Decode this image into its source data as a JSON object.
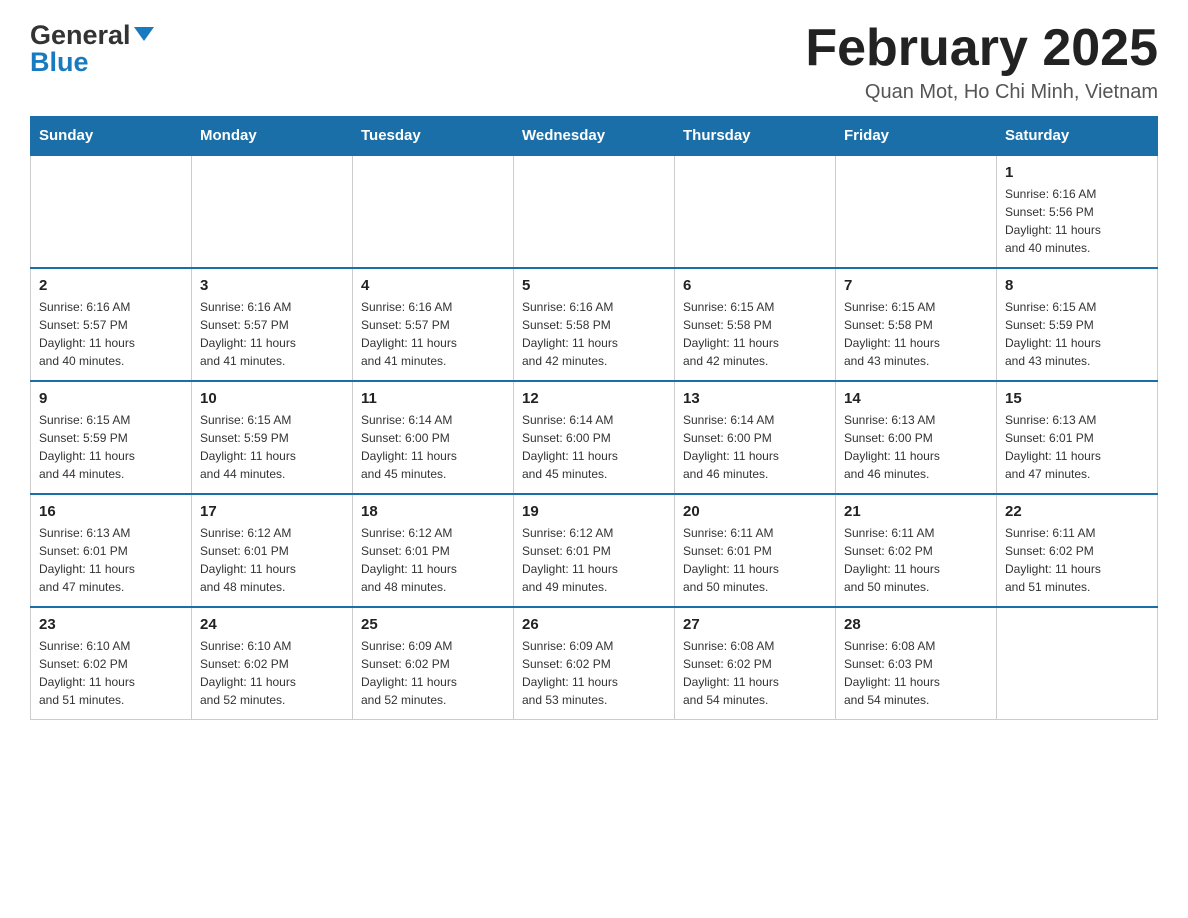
{
  "logo": {
    "general": "General",
    "blue": "Blue"
  },
  "header": {
    "title": "February 2025",
    "location": "Quan Mot, Ho Chi Minh, Vietnam"
  },
  "days_of_week": [
    "Sunday",
    "Monday",
    "Tuesday",
    "Wednesday",
    "Thursday",
    "Friday",
    "Saturday"
  ],
  "weeks": [
    [
      {
        "day": "",
        "info": ""
      },
      {
        "day": "",
        "info": ""
      },
      {
        "day": "",
        "info": ""
      },
      {
        "day": "",
        "info": ""
      },
      {
        "day": "",
        "info": ""
      },
      {
        "day": "",
        "info": ""
      },
      {
        "day": "1",
        "info": "Sunrise: 6:16 AM\nSunset: 5:56 PM\nDaylight: 11 hours\nand 40 minutes."
      }
    ],
    [
      {
        "day": "2",
        "info": "Sunrise: 6:16 AM\nSunset: 5:57 PM\nDaylight: 11 hours\nand 40 minutes."
      },
      {
        "day": "3",
        "info": "Sunrise: 6:16 AM\nSunset: 5:57 PM\nDaylight: 11 hours\nand 41 minutes."
      },
      {
        "day": "4",
        "info": "Sunrise: 6:16 AM\nSunset: 5:57 PM\nDaylight: 11 hours\nand 41 minutes."
      },
      {
        "day": "5",
        "info": "Sunrise: 6:16 AM\nSunset: 5:58 PM\nDaylight: 11 hours\nand 42 minutes."
      },
      {
        "day": "6",
        "info": "Sunrise: 6:15 AM\nSunset: 5:58 PM\nDaylight: 11 hours\nand 42 minutes."
      },
      {
        "day": "7",
        "info": "Sunrise: 6:15 AM\nSunset: 5:58 PM\nDaylight: 11 hours\nand 43 minutes."
      },
      {
        "day": "8",
        "info": "Sunrise: 6:15 AM\nSunset: 5:59 PM\nDaylight: 11 hours\nand 43 minutes."
      }
    ],
    [
      {
        "day": "9",
        "info": "Sunrise: 6:15 AM\nSunset: 5:59 PM\nDaylight: 11 hours\nand 44 minutes."
      },
      {
        "day": "10",
        "info": "Sunrise: 6:15 AM\nSunset: 5:59 PM\nDaylight: 11 hours\nand 44 minutes."
      },
      {
        "day": "11",
        "info": "Sunrise: 6:14 AM\nSunset: 6:00 PM\nDaylight: 11 hours\nand 45 minutes."
      },
      {
        "day": "12",
        "info": "Sunrise: 6:14 AM\nSunset: 6:00 PM\nDaylight: 11 hours\nand 45 minutes."
      },
      {
        "day": "13",
        "info": "Sunrise: 6:14 AM\nSunset: 6:00 PM\nDaylight: 11 hours\nand 46 minutes."
      },
      {
        "day": "14",
        "info": "Sunrise: 6:13 AM\nSunset: 6:00 PM\nDaylight: 11 hours\nand 46 minutes."
      },
      {
        "day": "15",
        "info": "Sunrise: 6:13 AM\nSunset: 6:01 PM\nDaylight: 11 hours\nand 47 minutes."
      }
    ],
    [
      {
        "day": "16",
        "info": "Sunrise: 6:13 AM\nSunset: 6:01 PM\nDaylight: 11 hours\nand 47 minutes."
      },
      {
        "day": "17",
        "info": "Sunrise: 6:12 AM\nSunset: 6:01 PM\nDaylight: 11 hours\nand 48 minutes."
      },
      {
        "day": "18",
        "info": "Sunrise: 6:12 AM\nSunset: 6:01 PM\nDaylight: 11 hours\nand 48 minutes."
      },
      {
        "day": "19",
        "info": "Sunrise: 6:12 AM\nSunset: 6:01 PM\nDaylight: 11 hours\nand 49 minutes."
      },
      {
        "day": "20",
        "info": "Sunrise: 6:11 AM\nSunset: 6:01 PM\nDaylight: 11 hours\nand 50 minutes."
      },
      {
        "day": "21",
        "info": "Sunrise: 6:11 AM\nSunset: 6:02 PM\nDaylight: 11 hours\nand 50 minutes."
      },
      {
        "day": "22",
        "info": "Sunrise: 6:11 AM\nSunset: 6:02 PM\nDaylight: 11 hours\nand 51 minutes."
      }
    ],
    [
      {
        "day": "23",
        "info": "Sunrise: 6:10 AM\nSunset: 6:02 PM\nDaylight: 11 hours\nand 51 minutes."
      },
      {
        "day": "24",
        "info": "Sunrise: 6:10 AM\nSunset: 6:02 PM\nDaylight: 11 hours\nand 52 minutes."
      },
      {
        "day": "25",
        "info": "Sunrise: 6:09 AM\nSunset: 6:02 PM\nDaylight: 11 hours\nand 52 minutes."
      },
      {
        "day": "26",
        "info": "Sunrise: 6:09 AM\nSunset: 6:02 PM\nDaylight: 11 hours\nand 53 minutes."
      },
      {
        "day": "27",
        "info": "Sunrise: 6:08 AM\nSunset: 6:02 PM\nDaylight: 11 hours\nand 54 minutes."
      },
      {
        "day": "28",
        "info": "Sunrise: 6:08 AM\nSunset: 6:03 PM\nDaylight: 11 hours\nand 54 minutes."
      },
      {
        "day": "",
        "info": ""
      }
    ]
  ]
}
